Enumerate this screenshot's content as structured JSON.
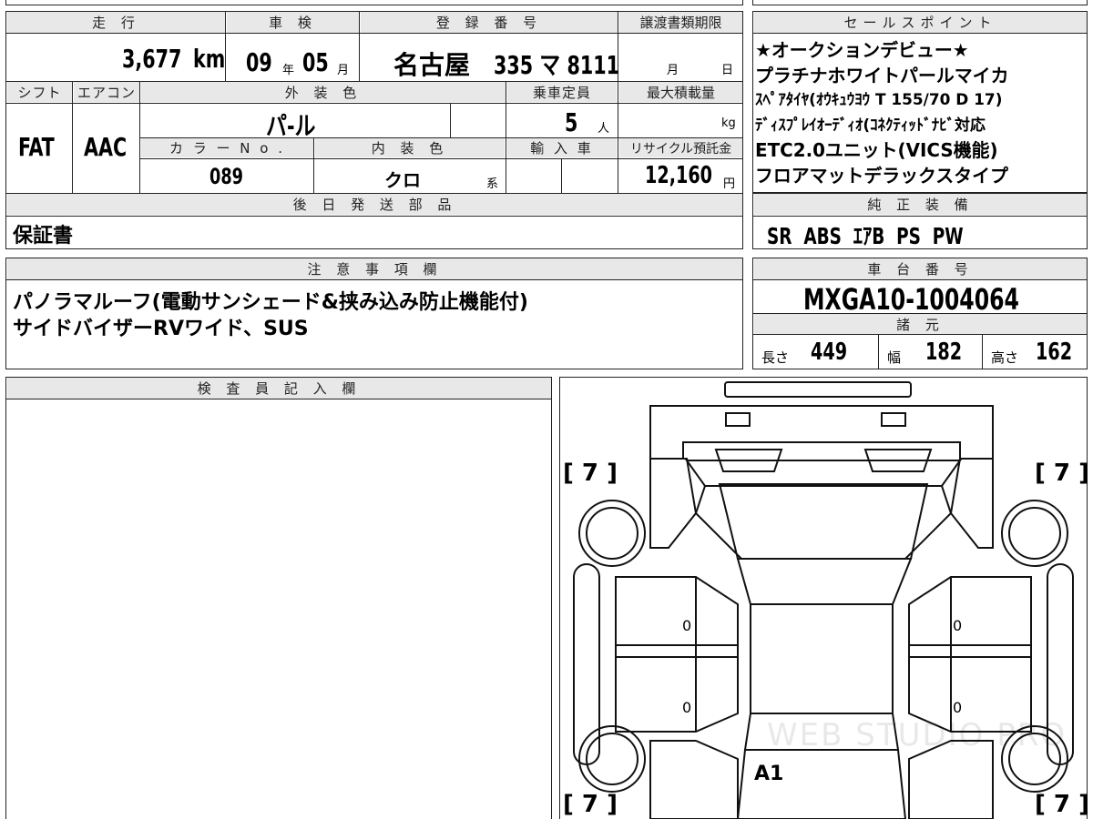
{
  "headers": {
    "mileage": "走 行",
    "inspection": "車 検",
    "registration": "登 録 番 号",
    "transfer_deadline": "譲渡書類期限",
    "shift": "シフト",
    "aircon": "エアコン",
    "exterior_color": "外 装 色",
    "capacity": "乗車定員",
    "max_load": "最大積載量",
    "color_no": "カ ラ ー N o .",
    "interior_color": "内 装 色",
    "import": "輸 入 車",
    "recycle": "リサイクル預託金",
    "later_parts": "後 日 発 送 部 品",
    "notes": "注 意 事 項 欄",
    "inspector": "検 査 員 記 入 欄",
    "sales_points": "セールスポイント",
    "equipment": "純 正 装 備",
    "chassis": "車 台 番 号",
    "specs": "諸 元"
  },
  "vehicle": {
    "mileage": "3,677",
    "mileage_unit": "km",
    "inspection_year": "09",
    "year_unit": "年",
    "inspection_month": "05",
    "month_unit": "月",
    "registration_place": "名古屋",
    "registration_number": "335 マ 8111",
    "transfer_month_unit": "月",
    "transfer_day_unit": "日",
    "shift": "FAT",
    "aircon": "AAC",
    "exterior_color": "パ-ル",
    "capacity": "5",
    "capacity_unit": "人",
    "max_load_unit": "kg",
    "color_no": "089",
    "interior_color": "クロ",
    "interior_suffix": "系",
    "recycle_fee": "12,160",
    "recycle_unit": "円"
  },
  "later_parts": "保証書",
  "notes": [
    "パノラマルーフ(電動サンシェード&挟み込み防止機能付)",
    "サイドバイザーRVワイド、SUS"
  ],
  "sales_points": [
    "★オークションデビュー★",
    "プラチナホワイトパールマイカ",
    "ｽﾍﾟｱﾀｲﾔ(ｵｳｷｭｳﾖｳ T 155/70 D 17)",
    "ﾃﾞｨｽﾌﾟﾚｲｵｰﾃﾞｨｵ(ｺﾈｸﾃｨｯﾄﾞﾅﾋﾞ対応",
    "ETC2.0ユニット(VICS機能)",
    "フロアマットデラックスタイプ"
  ],
  "equipment": "SR  ABS  ｴｱB  PS  PW",
  "chassis_number": "MXGA10-1004064",
  "specs": {
    "length_label": "長さ",
    "length": "449",
    "width_label": "幅",
    "width": "182",
    "height_label": "高さ",
    "height": "162"
  },
  "diagram": {
    "tire_tl": "[ 7 ]",
    "tire_tr": "[ 7 ]",
    "tire_bl": "[ 7 ]",
    "tire_br": "[ 7 ]",
    "door_fl": "0",
    "door_fr": "0",
    "door_rl": "0",
    "door_rr": "0",
    "mark": "A1",
    "watermark": "WEB STUDIO PRO"
  }
}
